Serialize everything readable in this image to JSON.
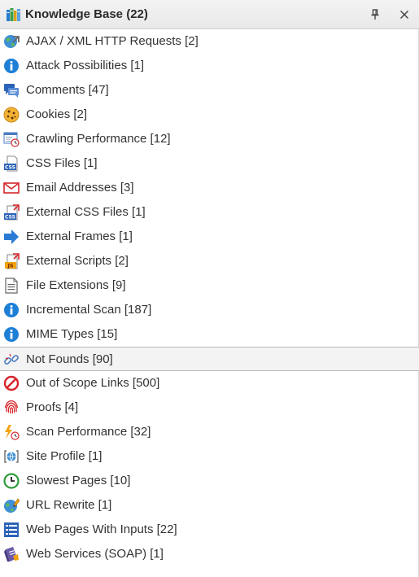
{
  "panel": {
    "title": "Knowledge Base (22)"
  },
  "items": [
    {
      "label": "AJAX / XML HTTP Requests [2]",
      "icon": "globe-arrow-icon"
    },
    {
      "label": "Attack Possibilities [1]",
      "icon": "info-icon"
    },
    {
      "label": "Comments [47]",
      "icon": "comments-icon"
    },
    {
      "label": "Cookies [2]",
      "icon": "cookie-icon"
    },
    {
      "label": "Crawling Performance [12]",
      "icon": "crawling-performance-icon"
    },
    {
      "label": "CSS Files [1]",
      "icon": "css-file-icon"
    },
    {
      "label": "Email Addresses [3]",
      "icon": "envelope-icon"
    },
    {
      "label": "External CSS Files [1]",
      "icon": "external-css-icon"
    },
    {
      "label": "External Frames [1]",
      "icon": "arrow-right-icon"
    },
    {
      "label": "External Scripts [2]",
      "icon": "external-js-icon"
    },
    {
      "label": "File Extensions [9]",
      "icon": "document-icon"
    },
    {
      "label": "Incremental Scan [187]",
      "icon": "info-icon"
    },
    {
      "label": "MIME Types [15]",
      "icon": "info-icon"
    },
    {
      "label": "Not Founds [90]",
      "icon": "broken-link-icon"
    },
    {
      "label": "Out of Scope Links [500]",
      "icon": "no-entry-icon"
    },
    {
      "label": "Proofs [4]",
      "icon": "fingerprint-icon"
    },
    {
      "label": "Scan Performance [32]",
      "icon": "lightning-clock-icon"
    },
    {
      "label": "Site Profile [1]",
      "icon": "globe-brackets-icon"
    },
    {
      "label": "Slowest Pages [10]",
      "icon": "clock-icon"
    },
    {
      "label": "URL Rewrite [1]",
      "icon": "globe-pencil-icon"
    },
    {
      "label": "Web Pages With Inputs [22]",
      "icon": "form-list-icon"
    },
    {
      "label": "Web Services (SOAP) [1]",
      "icon": "web-services-icon"
    }
  ],
  "selected_item": "Not Founds [90]",
  "colors": {
    "info_blue": "#1e7fd6",
    "red": "#d6262b",
    "green": "#2e9b3a",
    "orange": "#f2a20f",
    "header_bg": "#ececec",
    "selection_bg": "#f3f3f3"
  }
}
